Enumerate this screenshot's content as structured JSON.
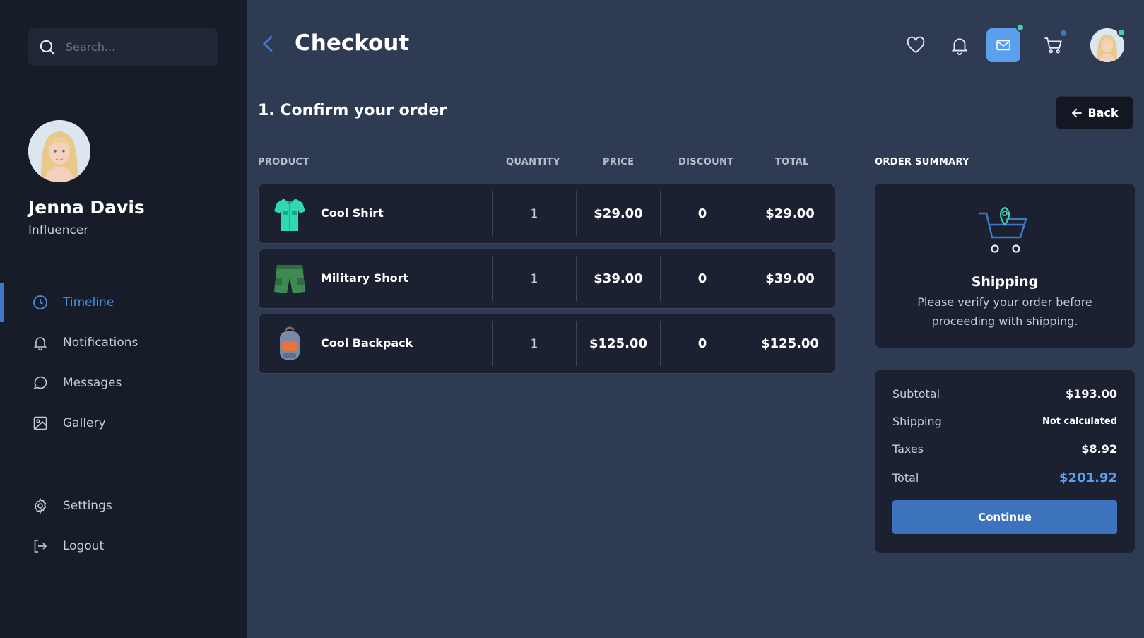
{
  "sidebar": {
    "search_placeholder": "Search...",
    "profile": {
      "name": "Jenna Davis",
      "role": "Influencer"
    },
    "nav": [
      {
        "label": "Timeline",
        "icon": "clock-icon",
        "active": true
      },
      {
        "label": "Notifications",
        "icon": "bell-icon"
      },
      {
        "label": "Messages",
        "icon": "message-icon"
      },
      {
        "label": "Gallery",
        "icon": "image-icon"
      }
    ],
    "bottom_nav": [
      {
        "label": "Settings",
        "icon": "gear-icon"
      },
      {
        "label": "Logout",
        "icon": "logout-icon"
      }
    ]
  },
  "header": {
    "title": "Checkout",
    "icons": [
      "heart-icon",
      "bell-icon",
      "mail-icon",
      "cart-icon"
    ]
  },
  "main": {
    "section_title": "1. Confirm your order",
    "back_label": "Back",
    "columns": [
      "PRODUCT",
      "QUANTITY",
      "PRICE",
      "DISCOUNT",
      "TOTAL"
    ],
    "items": [
      {
        "name": "Cool Shirt",
        "quantity": "1",
        "price": "$29.00",
        "discount": "0",
        "total": "$29.00"
      },
      {
        "name": "Military Short",
        "quantity": "1",
        "price": "$39.00",
        "discount": "0",
        "total": "$39.00"
      },
      {
        "name": "Cool Backpack",
        "quantity": "1",
        "price": "$125.00",
        "discount": "0",
        "total": "$125.00"
      }
    ]
  },
  "summary": {
    "title": "ORDER SUMMARY",
    "shipping_title": "Shipping",
    "shipping_desc": "Please verify your order before proceeding with shipping.",
    "subtotal_label": "Subtotal",
    "subtotal": "$193.00",
    "shipping_label": "Shipping",
    "shipping": "Not calculated",
    "taxes_label": "Taxes",
    "taxes": "$8.92",
    "total_label": "Total",
    "total": "$201.92",
    "continue_label": "Continue"
  },
  "colors": {
    "accent": "#5aa0ef",
    "button": "#3d72bd",
    "notification_dot_green": "#3fd1b1",
    "notification_dot_blue": "#3f78c5"
  }
}
